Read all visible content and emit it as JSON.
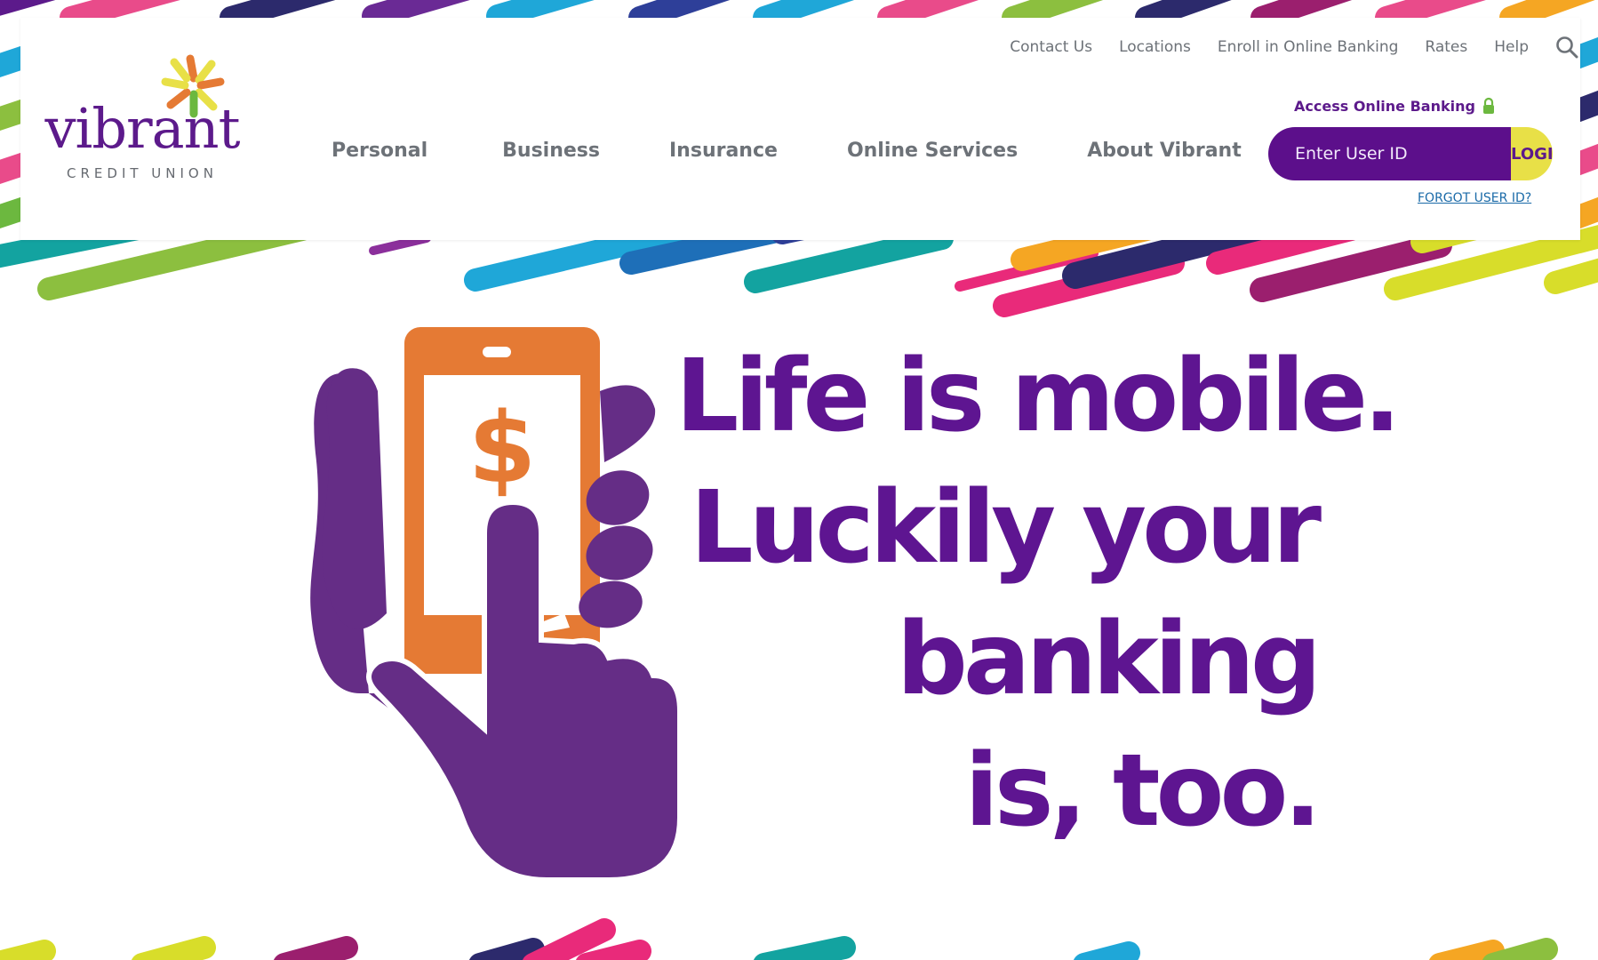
{
  "brand": {
    "name": "vibrant",
    "tagline": "CREDIT UNION",
    "colors": {
      "purple": "#5c1a8b",
      "orange": "#e57a34",
      "yellow": "#e8e047",
      "green": "#6cb83f",
      "gray": "#6d7278",
      "link": "#1a6aa8"
    }
  },
  "utility_nav": {
    "items": [
      {
        "label": "Contact Us"
      },
      {
        "label": "Locations"
      },
      {
        "label": "Enroll in Online Banking"
      },
      {
        "label": "Rates"
      },
      {
        "label": "Help"
      }
    ],
    "search_icon": "search-icon"
  },
  "main_nav": {
    "items": [
      {
        "label": "Personal"
      },
      {
        "label": "Business"
      },
      {
        "label": "Insurance"
      },
      {
        "label": "Online Services"
      },
      {
        "label": "About Vibrant"
      }
    ]
  },
  "login": {
    "access_label": "Access Online Banking",
    "lock_icon": "lock-icon",
    "user_id_placeholder": "Enter User ID",
    "user_id_value": "",
    "button_label": "LOGIN",
    "forgot_label": "FORGOT USER ID?"
  },
  "hero": {
    "headline_lines": [
      "Life is mobile.",
      "Luckily your",
      "banking",
      "is, too."
    ],
    "illustration_icon": "hand-holding-phone-icon",
    "dollar_glyph": "$"
  }
}
